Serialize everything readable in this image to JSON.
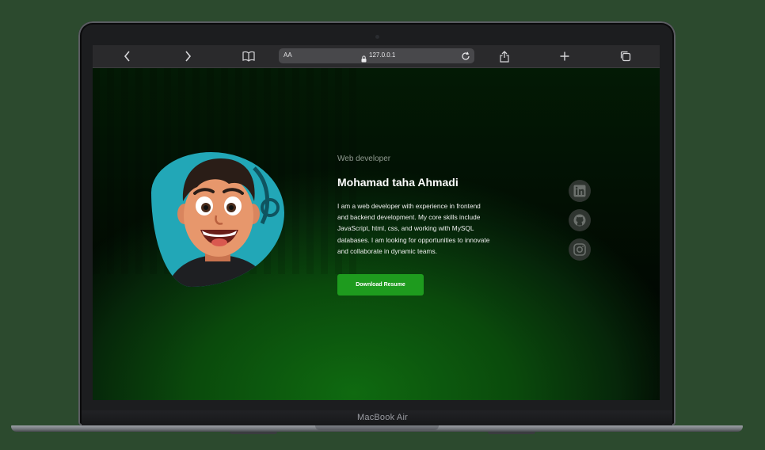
{
  "browser": {
    "address_text_size": "AA",
    "url": "127.0.0.1",
    "icons": [
      "back-icon",
      "forward-icon",
      "bookmarks-icon",
      "lock-icon",
      "reload-icon",
      "share-icon",
      "new-tab-icon",
      "tabs-icon"
    ]
  },
  "profile": {
    "subtitle": "Web developer",
    "name": "Mohamad taha Ahmadi",
    "bio": "I am a web developer with experience in frontend and backend development. My core skills include JavaScript, html, css, and working with MySQL databases. I am looking for opportunities to innovate and collaborate in dynamic teams.",
    "resume_button": "Download Resume",
    "accent_color": "#1e9b1e"
  },
  "social": [
    "linkedin-icon",
    "github-icon",
    "instagram-icon"
  ],
  "device": {
    "label": "MacBook Air"
  }
}
